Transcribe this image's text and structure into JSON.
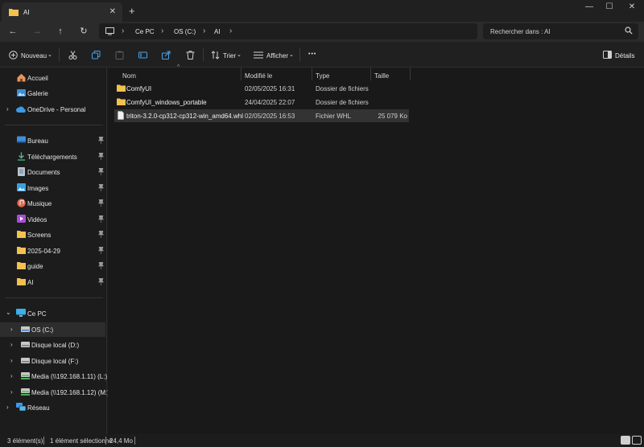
{
  "window": {
    "tab_title": "AI",
    "tab_close": "✕",
    "new_tab": "+",
    "controls": {
      "minimize": "—",
      "maximize": "☐",
      "close": "✕"
    }
  },
  "nav": {
    "back": "←",
    "forward": "→",
    "up": "↑",
    "refresh": "↻",
    "breadcrumb": [
      "Ce PC",
      "OS (C:)",
      "AI"
    ],
    "search_placeholder": "Rechercher dans : AI"
  },
  "toolbar": {
    "new_label": "Nouveau",
    "sort_label": "Trier",
    "view_label": "Afficher",
    "more_label": "•••",
    "details_label": "Détails"
  },
  "sidebar": {
    "top": [
      {
        "label": "Accueil",
        "icon": "home-icon"
      },
      {
        "label": "Galerie",
        "icon": "gallery-icon"
      },
      {
        "label": "OneDrive - Personal",
        "icon": "cloud-icon"
      }
    ],
    "quick": [
      {
        "label": "Bureau",
        "icon": "desktop-icon"
      },
      {
        "label": "Téléchargements",
        "icon": "download-icon"
      },
      {
        "label": "Documents",
        "icon": "documents-icon"
      },
      {
        "label": "Images",
        "icon": "images-icon"
      },
      {
        "label": "Musique",
        "icon": "music-icon"
      },
      {
        "label": "Vidéos",
        "icon": "videos-icon"
      },
      {
        "label": "Screens",
        "icon": "folder-icon"
      },
      {
        "label": "2025-04-29",
        "icon": "folder-icon"
      },
      {
        "label": "guide",
        "icon": "folder-icon"
      },
      {
        "label": "AI",
        "icon": "folder-icon"
      }
    ],
    "pc": {
      "label": "Ce PC",
      "icon": "pc-icon"
    },
    "drives": [
      {
        "label": "OS (C:)",
        "icon": "drive-icon"
      },
      {
        "label": "Disque local (D:)",
        "icon": "drive-icon"
      },
      {
        "label": "Disque local (F:)",
        "icon": "drive-icon"
      },
      {
        "label": "Media (\\\\192.168.1.11) (L:)",
        "icon": "network-drive-icon"
      },
      {
        "label": "Media (\\\\192.168.1.12) (M:)",
        "icon": "network-drive-icon"
      }
    ],
    "network": {
      "label": "Réseau",
      "icon": "network-icon"
    }
  },
  "columns": {
    "name": "Nom",
    "modified": "Modifié le",
    "type": "Type",
    "size": "Taille"
  },
  "files": [
    {
      "name": "ComfyUI",
      "modified": "02/05/2025 16:31",
      "type": "Dossier de fichiers",
      "size": ""
    },
    {
      "name": "ComfyUI_windows_portable",
      "modified": "24/04/2025 22:07",
      "type": "Dossier de fichiers",
      "size": ""
    },
    {
      "name": "triton-3.2.0-cp312-cp312-win_amd64.whl",
      "modified": "02/05/2025 16:53",
      "type": "Fichier WHL",
      "size": "25 079 Ko"
    }
  ],
  "status": {
    "count": "3 élément(s)",
    "selected": "1 élément sélectionné",
    "size": "24,4 Mo"
  }
}
